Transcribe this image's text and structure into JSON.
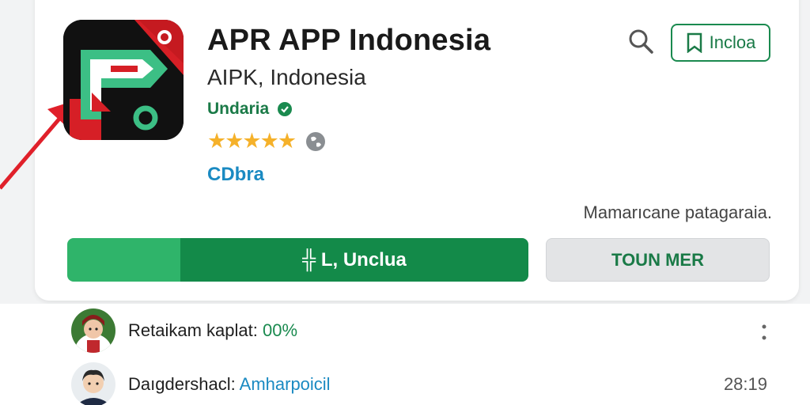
{
  "app": {
    "title": "APR APP Indonesia",
    "subtitle": "AIPK, Indonesia",
    "developer": "Undaria",
    "rating_stars": "★★★★★",
    "rating_value": 5,
    "category": "CDbra",
    "icon": "app-logo"
  },
  "header": {
    "search_icon": "search-icon",
    "follow_label": "Incloa",
    "follow_icon": "bookmark-icon"
  },
  "note": "Mamarıcane patagaraia.",
  "actions": {
    "install_label": "╬ L, Unclua",
    "secondary_label": "TOUN MER"
  },
  "list": [
    {
      "label": "Retaikam kaplat: ",
      "value": "00%",
      "value_color": "green",
      "trailing_icon": "more-vert-icon"
    },
    {
      "label": "Daıgdershacl: ",
      "value": "Amharpoicil",
      "value_color": "blue",
      "time": "28:19"
    }
  ],
  "colors": {
    "accent_green": "#138a49",
    "light_green": "#2fb46a",
    "star": "#f5b12a",
    "link_blue": "#1a8ac2"
  }
}
